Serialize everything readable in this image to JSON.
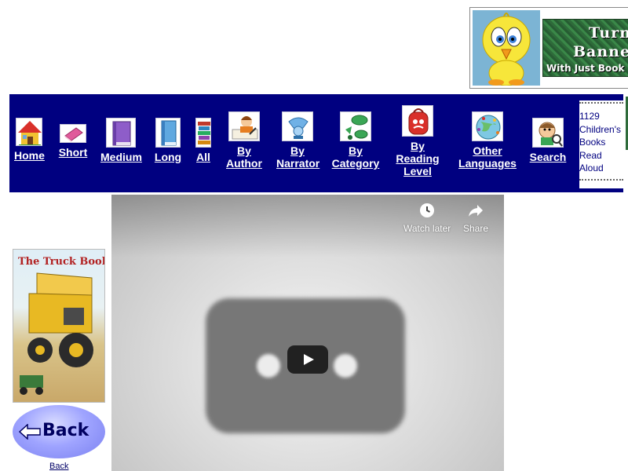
{
  "banner": {
    "line1": "Turn",
    "line2": "Banne",
    "line3": "With Just Book"
  },
  "nav": {
    "items": [
      {
        "label": "Home",
        "icon": "house-icon"
      },
      {
        "label": "Short",
        "icon": "pink-book-icon"
      },
      {
        "label": "Medium",
        "icon": "purple-book-icon"
      },
      {
        "label": "Long",
        "icon": "blue-book-icon"
      },
      {
        "label": "All",
        "icon": "book-stack-icon"
      },
      {
        "label": "By Author",
        "icon": "author-writing-icon"
      },
      {
        "label": "By Narrator",
        "icon": "narrator-icon"
      },
      {
        "label": "By Category",
        "icon": "category-icon"
      },
      {
        "label": "By Reading Level",
        "icon": "backpack-icon"
      },
      {
        "label": "Other Languages",
        "icon": "globe-people-icon"
      },
      {
        "label": "Search",
        "icon": "search-face-icon"
      }
    ],
    "counter": {
      "count": "1129",
      "line2": "Children's",
      "line3": "Books",
      "line4": "Read",
      "line5": "Aloud"
    },
    "colors": {
      "bar": "#000080",
      "text": "#ffffff"
    }
  },
  "book": {
    "title": "The Truck Book"
  },
  "back": {
    "button_label": "Back",
    "link_label": "Back"
  },
  "video": {
    "watch_later": "Watch later",
    "share": "Share",
    "play_icon": "play-icon"
  }
}
